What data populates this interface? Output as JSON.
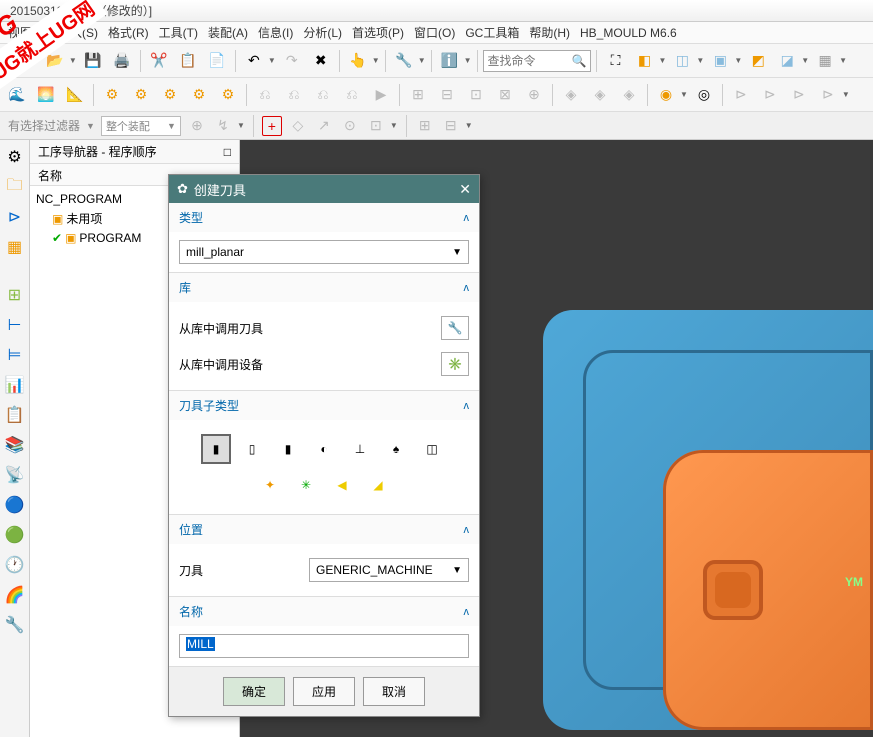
{
  "titlebar": "20150313-1.prt （修改的）]",
  "menu": {
    "view": "视图(V)",
    "insert": "插入(S)",
    "format": "格式(R)",
    "tools": "工具(T)",
    "assembly": "装配(A)",
    "info": "信息(I)",
    "analysis": "分析(L)",
    "preferences": "首选项(P)",
    "window": "窗口(O)",
    "gctools": "GC工具箱",
    "help": "帮助(H)",
    "hbmould": "HB_MOULD M6.6"
  },
  "search_placeholder": "查找命令",
  "filter_label": "有选择过滤器",
  "filter_combo": "整个装配",
  "nav": {
    "title": "工序导航器 - 程序顺序",
    "col_name": "名称",
    "root": "NC_PROGRAM",
    "unused": "未用项",
    "program": "PROGRAM"
  },
  "dialog": {
    "title": "创建刀具",
    "sec_type": "类型",
    "type_value": "mill_planar",
    "sec_lib": "库",
    "lib_tool": "从库中调用刀具",
    "lib_device": "从库中调用设备",
    "sec_subtype": "刀具子类型",
    "sec_position": "位置",
    "pos_label": "刀具",
    "pos_value": "GENERIC_MACHINE",
    "sec_name": "名称",
    "name_value": "MILL",
    "btn_ok": "确定",
    "btn_apply": "应用",
    "btn_cancel": "取消"
  },
  "axis_ym": "YM"
}
